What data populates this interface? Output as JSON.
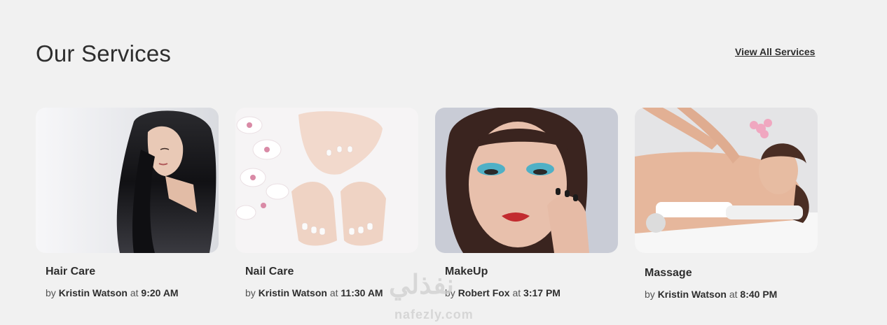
{
  "header": {
    "title": "Our Services",
    "view_all": "View All Services"
  },
  "services": [
    {
      "name": "Hair Care",
      "by": "by",
      "author": "Kristin Watson",
      "at": "at",
      "time": "9:20 AM",
      "image": "woman-long-black-hair"
    },
    {
      "name": "Nail Care",
      "by": "by",
      "author": "Kristin Watson",
      "at": "at",
      "time": "11:30 AM",
      "image": "manicured-hands-and-feet-with-orchids"
    },
    {
      "name": "MakeUp",
      "by": "by",
      "author": "Robert Fox",
      "at": "at",
      "time": "3:17 PM",
      "image": "woman-with-blue-eye-makeup"
    },
    {
      "name": "Massage",
      "by": "by",
      "author": "Kristin Watson",
      "at": "at",
      "time": "8:40 PM",
      "image": "woman-receiving-back-massage"
    }
  ],
  "watermark": {
    "text": "نفذلي",
    "site": "nafezly.com"
  }
}
